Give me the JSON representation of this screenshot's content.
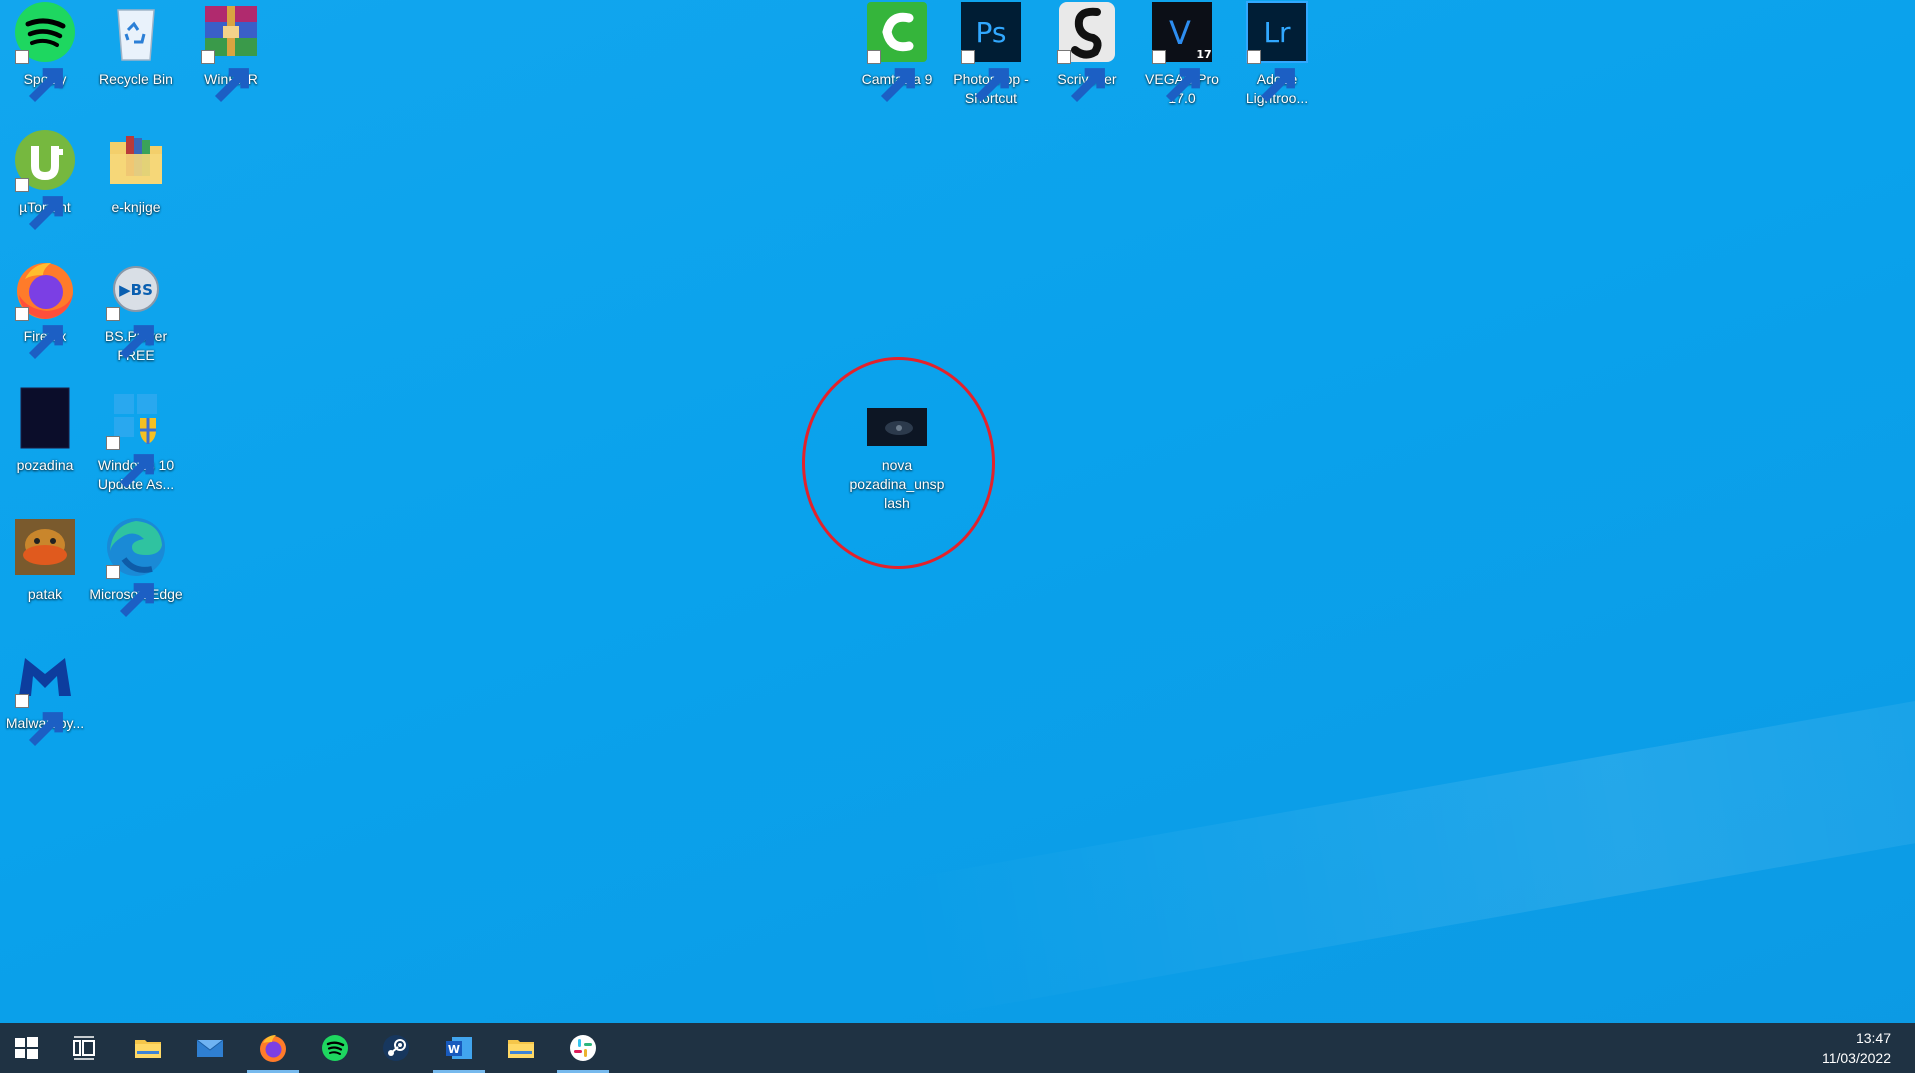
{
  "desktop": {
    "icons": [
      {
        "id": "spotify",
        "label": "Spotify",
        "icon": "spotify-icon",
        "shortcut": true
      },
      {
        "id": "recycle-bin",
        "label": "Recycle Bin",
        "icon": "recycle-bin-icon",
        "shortcut": false
      },
      {
        "id": "winrar",
        "label": "WinRAR",
        "icon": "winrar-icon",
        "shortcut": true
      },
      {
        "id": "utorrent",
        "label": "µTorrent",
        "icon": "utorrent-icon",
        "shortcut": true
      },
      {
        "id": "e-knjige",
        "label": "e-knjige",
        "icon": "archive-folder-icon",
        "shortcut": false
      },
      {
        "id": "firefox",
        "label": "Firefox",
        "icon": "firefox-icon",
        "shortcut": true
      },
      {
        "id": "bsplayer",
        "label": "BS.Player FREE",
        "icon": "bsplayer-icon",
        "shortcut": true
      },
      {
        "id": "pozadina",
        "label": "pozadina",
        "icon": "image-file-icon",
        "shortcut": false
      },
      {
        "id": "win10-update",
        "label": "Windows 10 Update As...",
        "icon": "windows-update-icon",
        "shortcut": true
      },
      {
        "id": "patak",
        "label": "patak",
        "icon": "image-file-icon",
        "shortcut": false
      },
      {
        "id": "edge",
        "label": "Microsoft Edge",
        "icon": "edge-icon",
        "shortcut": true
      },
      {
        "id": "malwarebytes",
        "label": "Malwareby...",
        "icon": "malwarebytes-icon",
        "shortcut": true
      },
      {
        "id": "camtasia",
        "label": "Camtasia 9",
        "icon": "camtasia-icon",
        "shortcut": true
      },
      {
        "id": "photoshop",
        "label": "Photoshop - Shortcut",
        "icon": "photoshop-icon",
        "shortcut": true,
        "glyph": "Ps"
      },
      {
        "id": "scrivener",
        "label": "Scrivener",
        "icon": "scrivener-icon",
        "shortcut": true
      },
      {
        "id": "vegas",
        "label": "VEGAS Pro 17.0",
        "icon": "vegas-icon",
        "shortcut": true,
        "glyph": "V",
        "badge": "17"
      },
      {
        "id": "lightroom",
        "label": "Adobe Lightroo...",
        "icon": "lightroom-icon",
        "shortcut": true,
        "glyph": "Lr"
      },
      {
        "id": "nova-pozadina",
        "label": "nova pozadina_unsplash",
        "icon": "image-file-icon",
        "shortcut": false,
        "highlighted": true
      }
    ],
    "highlight_color": "#e3222b"
  },
  "taskbar": {
    "buttons": [
      {
        "name": "start-button",
        "icon": "windows-logo-icon"
      },
      {
        "name": "task-view-button",
        "icon": "task-view-icon"
      },
      {
        "name": "file-explorer-button",
        "icon": "folder-icon"
      },
      {
        "name": "mail-button",
        "icon": "mail-icon"
      },
      {
        "name": "firefox-taskbar-button",
        "icon": "firefox-icon",
        "open": true
      },
      {
        "name": "spotify-taskbar-button",
        "icon": "spotify-icon"
      },
      {
        "name": "steam-taskbar-button",
        "icon": "steam-icon"
      },
      {
        "name": "word-taskbar-button",
        "icon": "word-icon",
        "open": true
      },
      {
        "name": "file-explorer-2-button",
        "icon": "folder-icon"
      },
      {
        "name": "slack-taskbar-button",
        "icon": "slack-icon",
        "open": true
      }
    ],
    "clock": {
      "time": "13:47",
      "date": "11/03/2022"
    },
    "background": "#1f3243"
  }
}
